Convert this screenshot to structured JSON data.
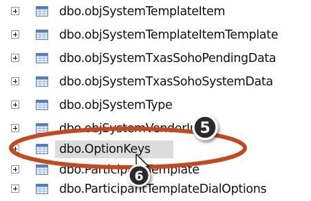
{
  "tree": {
    "items": [
      {
        "label": "dbo.objSystemTemplateItem",
        "icon": "table-icon",
        "expand": "+"
      },
      {
        "label": "dbo.objSystemTemplateItemTemplate",
        "icon": "table-icon",
        "expand": "+"
      },
      {
        "label": "dbo.objSystemTxasSohoPendingData",
        "icon": "table-icon",
        "expand": "+"
      },
      {
        "label": "dbo.objSystemTxasSohoSystemData",
        "icon": "table-icon",
        "expand": "+"
      },
      {
        "label": "dbo.objSystemType",
        "icon": "table-icon",
        "expand": "+"
      },
      {
        "label": "dbo.objSystemVendorInfo",
        "icon": "table-icon",
        "expand": "+"
      },
      {
        "label": "dbo.OptionKeys",
        "icon": "table-icon",
        "expand": "+",
        "selected": true
      },
      {
        "label": "dbo.ParticipantTemplate",
        "icon": "table-icon",
        "expand": "+"
      },
      {
        "label": "dbo.ParticipantTemplateDialOptions",
        "icon": "table-icon",
        "expand": "+"
      }
    ]
  },
  "annotations": {
    "callout_5": "5",
    "callout_6": "6"
  },
  "colors": {
    "highlight_ring": "#c8481e",
    "badge_fill": "#2b2b2b",
    "selection": "#dcdcdc",
    "table_icon_header": "#4f7ac7",
    "table_icon_body": "#e9f1fb"
  }
}
